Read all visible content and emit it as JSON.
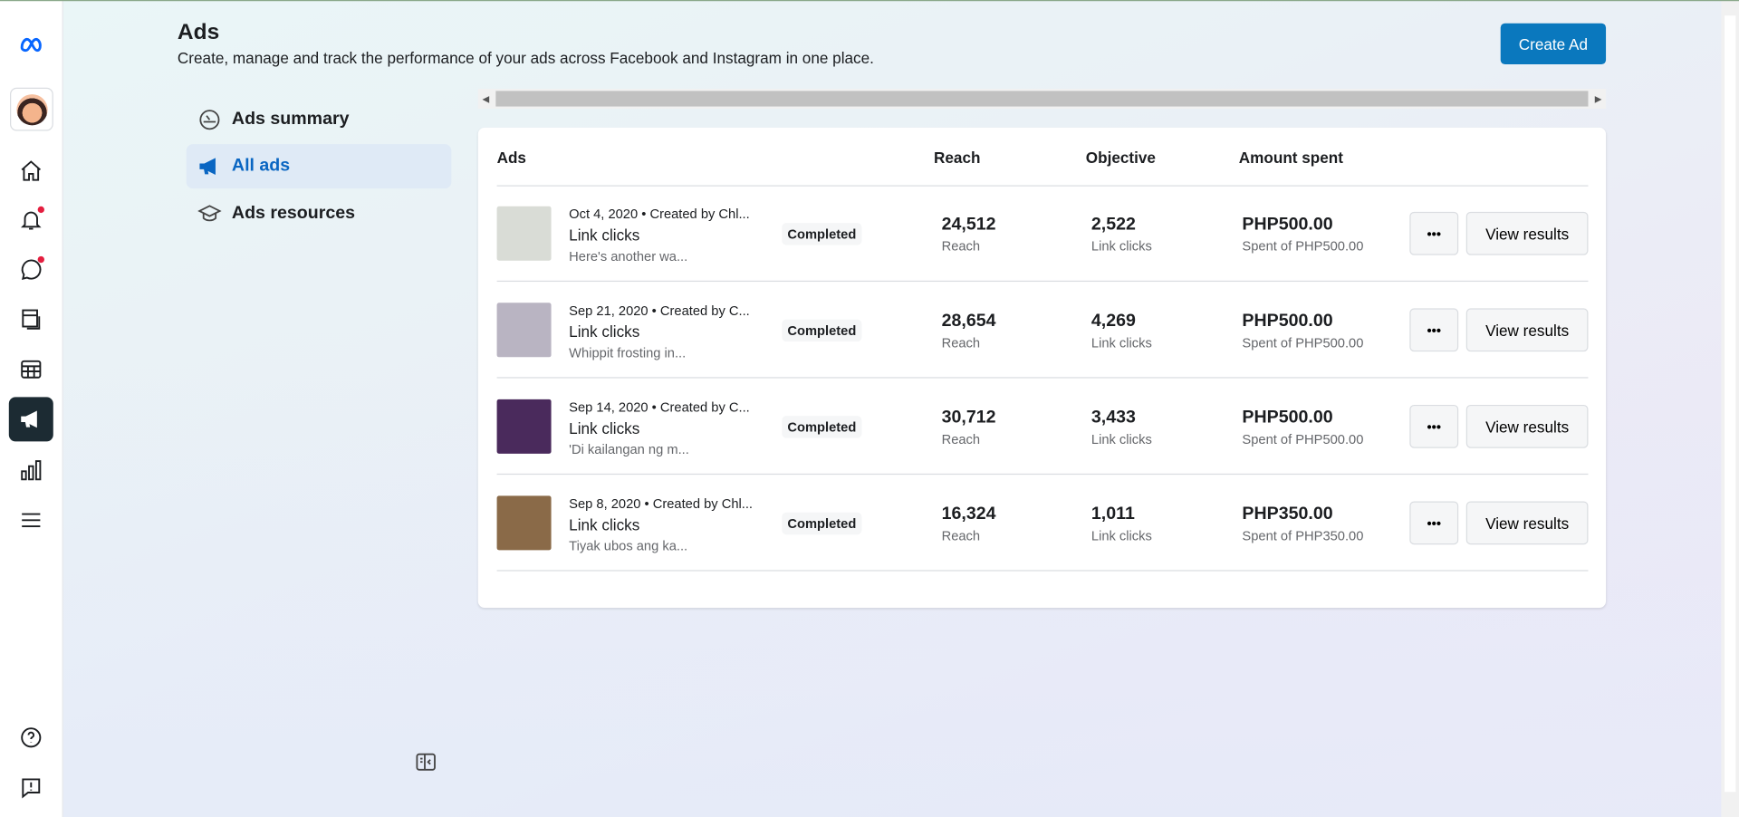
{
  "header": {
    "title": "Ads",
    "subtitle": "Create, manage and track the performance of your ads across Facebook and Instagram in one place.",
    "create_button": "Create Ad"
  },
  "nav": [
    {
      "label": "Ads summary",
      "icon": "gauge-icon"
    },
    {
      "label": "All ads",
      "icon": "megaphone-icon",
      "active": true
    },
    {
      "label": "Ads resources",
      "icon": "graduation-cap-icon"
    }
  ],
  "table": {
    "columns": [
      "Ads",
      "Reach",
      "Objective",
      "Amount spent"
    ],
    "rows": [
      {
        "date": "Oct 4, 2020",
        "created": "Created by Chl...",
        "objective": "Link clicks",
        "desc": "Here's another wa...",
        "status": "Completed",
        "reach": "24,512",
        "reach_label": "Reach",
        "results": "2,522",
        "results_label": "Link clicks",
        "amount": "PHP500.00",
        "spent": "Spent of PHP500.00",
        "more": "•••",
        "view": "View results",
        "thumb_color": "#d9dcd6"
      },
      {
        "date": "Sep 21, 2020",
        "created": "Created by C...",
        "objective": "Link clicks",
        "desc": "Whippit frosting in...",
        "status": "Completed",
        "reach": "28,654",
        "reach_label": "Reach",
        "results": "4,269",
        "results_label": "Link clicks",
        "amount": "PHP500.00",
        "spent": "Spent of PHP500.00",
        "more": "•••",
        "view": "View results",
        "thumb_color": "#b9b4c2"
      },
      {
        "date": "Sep 14, 2020",
        "created": "Created by C...",
        "objective": "Link clicks",
        "desc": "'Di kailangan ng m...",
        "status": "Completed",
        "reach": "30,712",
        "reach_label": "Reach",
        "results": "3,433",
        "results_label": "Link clicks",
        "amount": "PHP500.00",
        "spent": "Spent of PHP500.00",
        "more": "•••",
        "view": "View results",
        "thumb_color": "#4a2a5c"
      },
      {
        "date": "Sep 8, 2020",
        "created": "Created by Chl...",
        "objective": "Link clicks",
        "desc": "Tiyak ubos ang ka...",
        "status": "Completed",
        "reach": "16,324",
        "reach_label": "Reach",
        "results": "1,011",
        "results_label": "Link clicks",
        "amount": "PHP350.00",
        "spent": "Spent of PHP350.00",
        "more": "•••",
        "view": "View results",
        "thumb_color": "#8a6a48"
      }
    ]
  }
}
